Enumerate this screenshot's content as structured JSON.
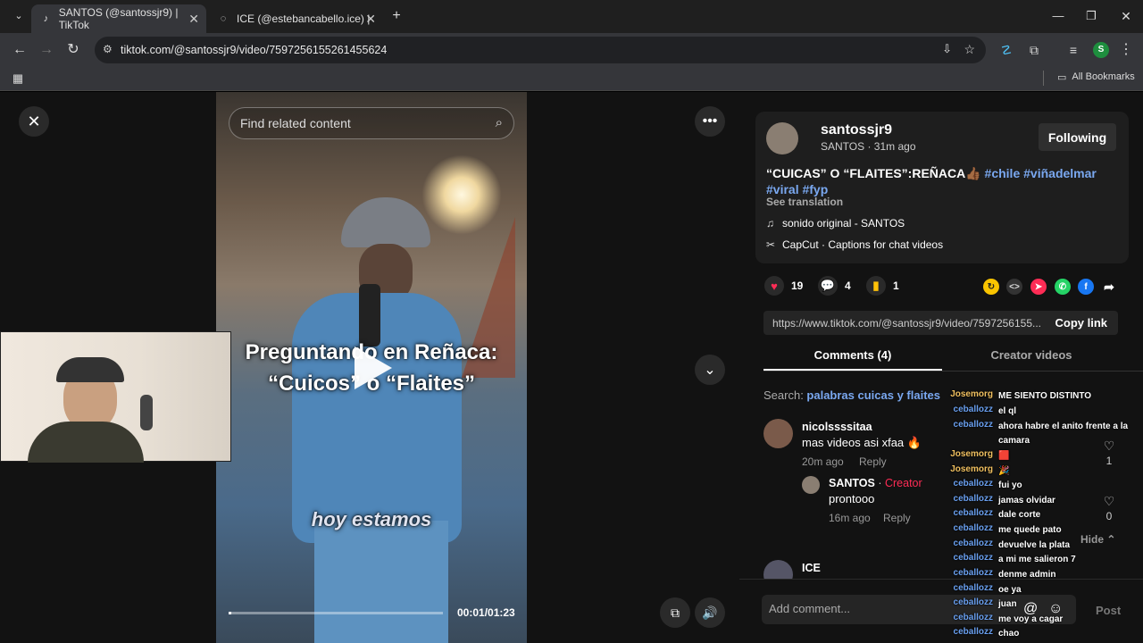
{
  "browser": {
    "tabs": [
      {
        "title": "SANTOS (@santossjr9) | TikTok",
        "active": true
      },
      {
        "title": "ICE (@estebancabello.ice) | TikT",
        "active": false
      }
    ],
    "url": "tiktok.com/@santossjr9/video/7597256155261455624",
    "bookmarks_label": "All Bookmarks",
    "profile_initial": "S"
  },
  "video": {
    "search_placeholder": "Find related content",
    "overlay_title_line1": "Preguntando en Reñaca:",
    "overlay_title_line2": "“Cuicos” o “Flaites”",
    "overlay_subtitle": "hoy estamos",
    "time": "00:01/01:23",
    "progress": 0.012
  },
  "post": {
    "username": "santossjr9",
    "subline": "SANTOS · 31m ago",
    "follow_label": "Following",
    "caption_text": "“CUICAS” O “FLAITES”:REÑACA👍🏾 ",
    "caption_tags": [
      "#chile",
      "#viñadelmar",
      "#viral",
      "#fyp"
    ],
    "see_translation": "See translation",
    "sound": "sonido original - SANTOS",
    "capcut": "CapCut · Captions for chat videos",
    "likes": "19",
    "comments_count": "4",
    "saves": "1",
    "link": "https://www.tiktok.com/@santossjr9/video/7597256155...",
    "copy_link": "Copy link",
    "tab_comments": "Comments (4)",
    "tab_creator": "Creator videos",
    "search_prefix": "Search: ",
    "search_query": "palabras cuicas y flaites"
  },
  "comments": [
    {
      "user": "nicolssssitaa",
      "text": "mas videos asi xfaa 🔥",
      "time": "20m ago",
      "reply": "Reply",
      "likes": "1"
    },
    {
      "user": "SANTOS",
      "badge": "Creator",
      "text": "prontooo",
      "time": "16m ago",
      "reply": "Reply",
      "likes": "0"
    },
    {
      "user": "ICE"
    }
  ],
  "hide_label": "Hide",
  "add_comment_placeholder": "Add comment...",
  "post_label": "Post",
  "chat": [
    {
      "user": "Josemorg",
      "msg": "ME SIENTO DISTINTO",
      "color": "#f0c060"
    },
    {
      "user": "ceballozz",
      "msg": "el ql",
      "color": "#6aa0f0"
    },
    {
      "user": "ceballozz",
      "msg": "ahora habre el anito frente a la camara",
      "color": "#6aa0f0"
    },
    {
      "user": "Josemorg",
      "msg": "🟥",
      "color": "#f0c060"
    },
    {
      "user": "Josemorg",
      "msg": "🎉",
      "color": "#f0c060"
    },
    {
      "user": "ceballozz",
      "msg": "fui yo",
      "color": "#6aa0f0"
    },
    {
      "user": "ceballozz",
      "msg": "jamas olvidar",
      "color": "#6aa0f0"
    },
    {
      "user": "ceballozz",
      "msg": "dale corte",
      "color": "#6aa0f0"
    },
    {
      "user": "ceballozz",
      "msg": "me quede pato",
      "color": "#6aa0f0"
    },
    {
      "user": "ceballozz",
      "msg": "devuelve la plata",
      "color": "#6aa0f0"
    },
    {
      "user": "ceballozz",
      "msg": "a mi me salieron 7",
      "color": "#6aa0f0"
    },
    {
      "user": "ceballozz",
      "msg": "denme admin",
      "color": "#6aa0f0"
    },
    {
      "user": "ceballozz",
      "msg": "oe ya",
      "color": "#6aa0f0"
    },
    {
      "user": "ceballozz",
      "msg": "juan",
      "color": "#6aa0f0"
    },
    {
      "user": "ceballozz",
      "msg": "me voy a cagar",
      "color": "#6aa0f0"
    },
    {
      "user": "ceballozz",
      "msg": "chao",
      "color": "#6aa0f0"
    }
  ]
}
